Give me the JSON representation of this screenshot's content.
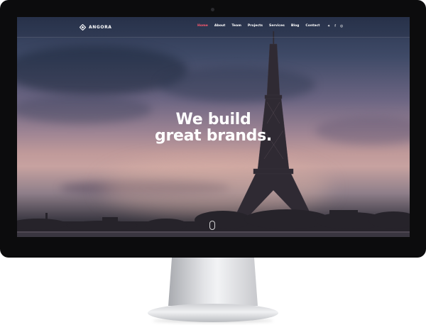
{
  "brand": {
    "name": "ANGORA"
  },
  "nav": {
    "items": [
      {
        "label": "Home",
        "active": true
      },
      {
        "label": "About",
        "active": false
      },
      {
        "label": "Team",
        "active": false
      },
      {
        "label": "Projects",
        "active": false
      },
      {
        "label": "Services",
        "active": false
      },
      {
        "label": "Blog",
        "active": false
      },
      {
        "label": "Contact",
        "active": false
      }
    ],
    "active_color": "#ff5a6e"
  },
  "social": {
    "icons": [
      "twitter-icon",
      "facebook-icon",
      "instagram-icon"
    ],
    "glyphs": [
      "✦",
      "f",
      "◎"
    ]
  },
  "hero": {
    "title_line1": "We build",
    "title_line2": "great brands."
  }
}
